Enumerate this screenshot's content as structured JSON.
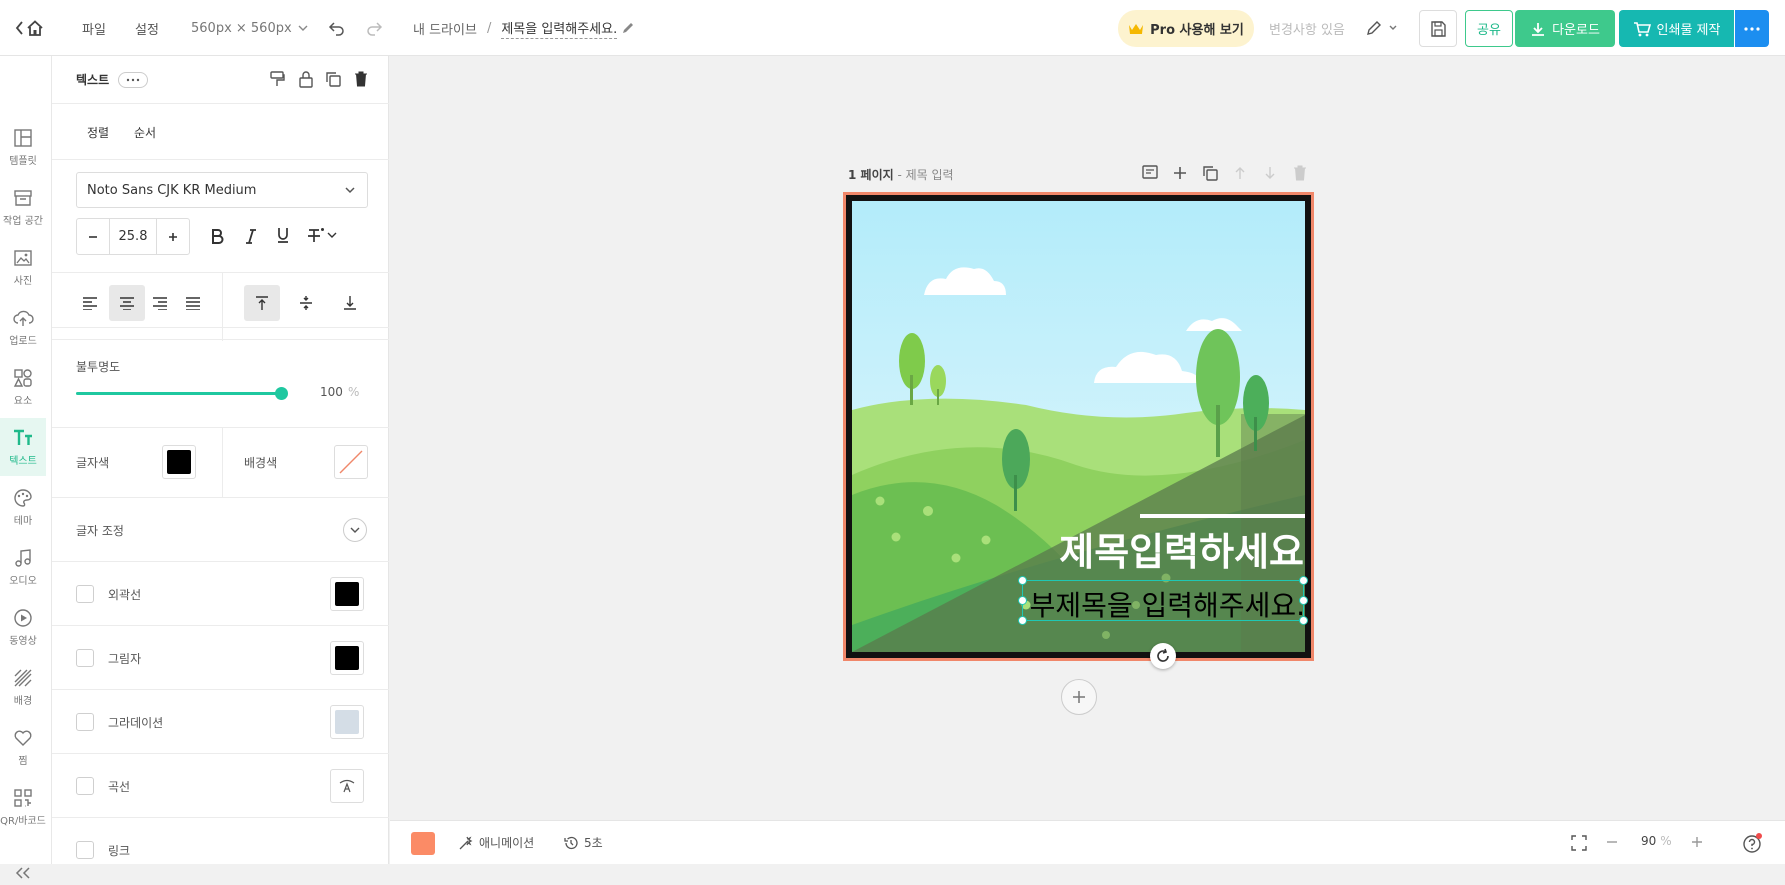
{
  "topbar": {
    "menu_file": "파일",
    "menu_settings": "설정",
    "size": "560px × 560px",
    "breadcrumb_root": "내 드라이브",
    "breadcrumb_sep": "/",
    "doc_title": "제목을 입력해주세요.",
    "pro_label": "Pro 사용해 보기",
    "status": "변경사항 있음",
    "share_label": "공유",
    "download_label": "다운로드",
    "print_label": "인쇄물 제작"
  },
  "rail": {
    "items": [
      {
        "label": "템플릿",
        "icon": "template-icon"
      },
      {
        "label": "작업 공간",
        "icon": "archive-icon"
      },
      {
        "label": "사진",
        "icon": "photo-icon"
      },
      {
        "label": "업로드",
        "icon": "upload-icon"
      },
      {
        "label": "요소",
        "icon": "shapes-icon"
      },
      {
        "label": "텍스트",
        "icon": "text-icon"
      },
      {
        "label": "테마",
        "icon": "palette-icon"
      },
      {
        "label": "오디오",
        "icon": "music-icon"
      },
      {
        "label": "동영상",
        "icon": "play-icon"
      },
      {
        "label": "배경",
        "icon": "pattern-icon"
      },
      {
        "label": "찜",
        "icon": "heart-icon"
      },
      {
        "label": "QR/바코드",
        "icon": "qr-icon"
      }
    ]
  },
  "panel": {
    "header_title": "텍스트",
    "tab_align": "정렬",
    "tab_order": "순서",
    "font_name": "Noto Sans CJK KR Medium",
    "font_size": "25.8",
    "opacity_label": "불투명도",
    "opacity_value": "100",
    "opacity_percent": 1.0,
    "opacity_unit": "%",
    "text_color_label": "글자색",
    "bg_color_label": "배경색",
    "text_color": "#000000",
    "adjust_label": "글자 조정",
    "options": [
      {
        "label": "외곽선",
        "swatch": "#000000",
        "checked": false
      },
      {
        "label": "그림자",
        "swatch": "#000000",
        "checked": false
      },
      {
        "label": "그라데이션",
        "swatch": "#d4dde6",
        "checked": false
      },
      {
        "label": "곡선",
        "swatch": "",
        "checked": false
      },
      {
        "label": "링크",
        "swatch": "",
        "checked": false
      }
    ]
  },
  "canvas": {
    "page_label_bold": "1 페이지",
    "page_label_rest": " - 제목 입력",
    "title_text": "제목입력하세요",
    "subtitle_text": "부제목을 입력해주세요.",
    "sky_color": "#b3ecfa",
    "accent_color": "#1fc8b4"
  },
  "bottombar": {
    "color_chip": "#fb8b66",
    "animation_label": "애니메이션",
    "duration_label": "5초",
    "zoom_value": "90",
    "zoom_unit": "%"
  },
  "colors": {
    "green": "#3ec98c",
    "teal": "#16b8b1",
    "blue": "#1c8ef0",
    "pro_bg": "#fdf3cf",
    "canvas_border": "#f0876a"
  }
}
